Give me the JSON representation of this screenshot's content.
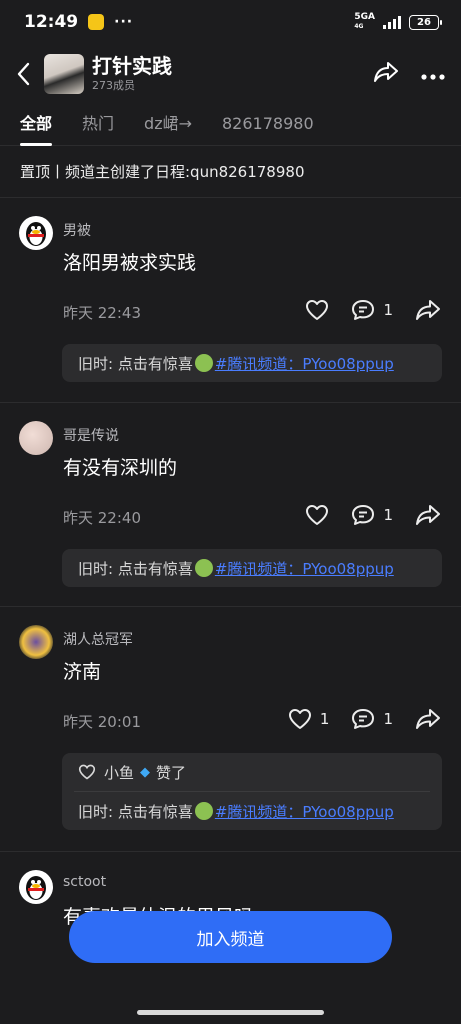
{
  "status": {
    "time": "12:49",
    "dots": "···",
    "network": "5GA",
    "network_sub": "4G",
    "battery": "26"
  },
  "header": {
    "channel_name": "打针实践",
    "member_count": "273成员"
  },
  "tabs": [
    "全部",
    "热门",
    "dz峮→",
    "826178980"
  ],
  "pinned": "置顶丨频道主创建了日程:qun826178980",
  "posts": [
    {
      "author": "男被",
      "content": "洛阳男被求实践",
      "time": "昨天 22:43",
      "like_count": "",
      "comment_count": "1",
      "card": {
        "prefix": "旧时: 点击有惊喜",
        "link": "#腾讯频道：PYoo08ppup"
      }
    },
    {
      "author": "哥是传说",
      "content": "有没有深圳的",
      "time": "昨天 22:40",
      "like_count": "",
      "comment_count": "1",
      "card": {
        "prefix": "旧时: 点击有惊喜",
        "link": "#腾讯频道：PYoo08ppup"
      }
    },
    {
      "author": "湖人总冠军",
      "content": "济南",
      "time": "昨天 20:01",
      "like_count": "1",
      "comment_count": "1",
      "liked_by": {
        "name": "小鱼",
        "action": "赞了"
      },
      "card": {
        "prefix": "旧时: 点击有惊喜",
        "link": "#腾讯频道：PYoo08ppup"
      }
    },
    {
      "author": "sctoot",
      "content": "有喜欢最体温的男风吗"
    }
  ],
  "join_button": "加入频道",
  "colors": {
    "background": "#1c1c1e",
    "accent": "#2f6df6",
    "link": "#4a7dff",
    "card": "#2c2c2e"
  }
}
